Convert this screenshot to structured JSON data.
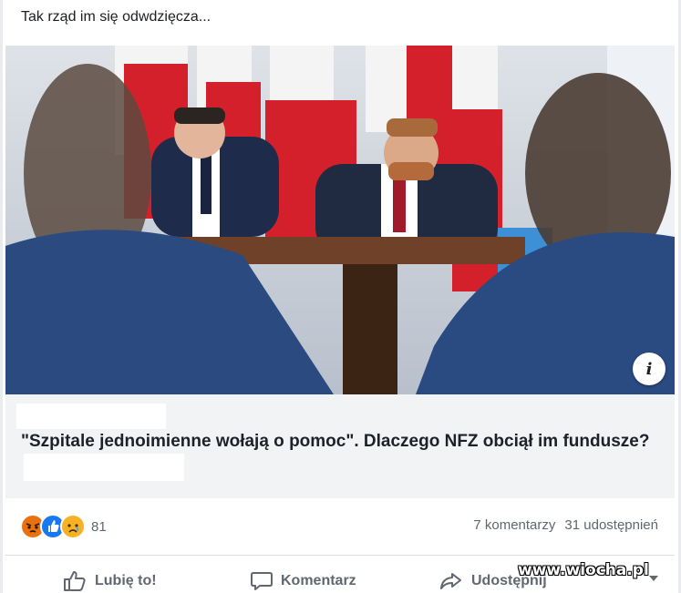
{
  "post": {
    "text": "Tak rząd im się odwdzięcza..."
  },
  "link": {
    "headline": "\"Szpitale jednoimienne wołają o pomoc\". Dlaczego NFZ obciął im fundusze?",
    "info_icon": "info-icon",
    "info_label": "i"
  },
  "reactions": {
    "icons": [
      "angry-reaction-icon",
      "like-reaction-icon",
      "sad-reaction-icon"
    ],
    "count": "81",
    "comments": "7 komentarzy",
    "shares": "31 udostępnień"
  },
  "actions": {
    "like_label": "Lubię to!",
    "comment_label": "Komentarz",
    "share_label": "Udostępnij"
  },
  "watermark": "www.wiocha.pl",
  "colors": {
    "facebook_blue": "#1877f2",
    "angry": "#e9710f",
    "sad": "#f7b125",
    "secondary_text": "#606770"
  }
}
